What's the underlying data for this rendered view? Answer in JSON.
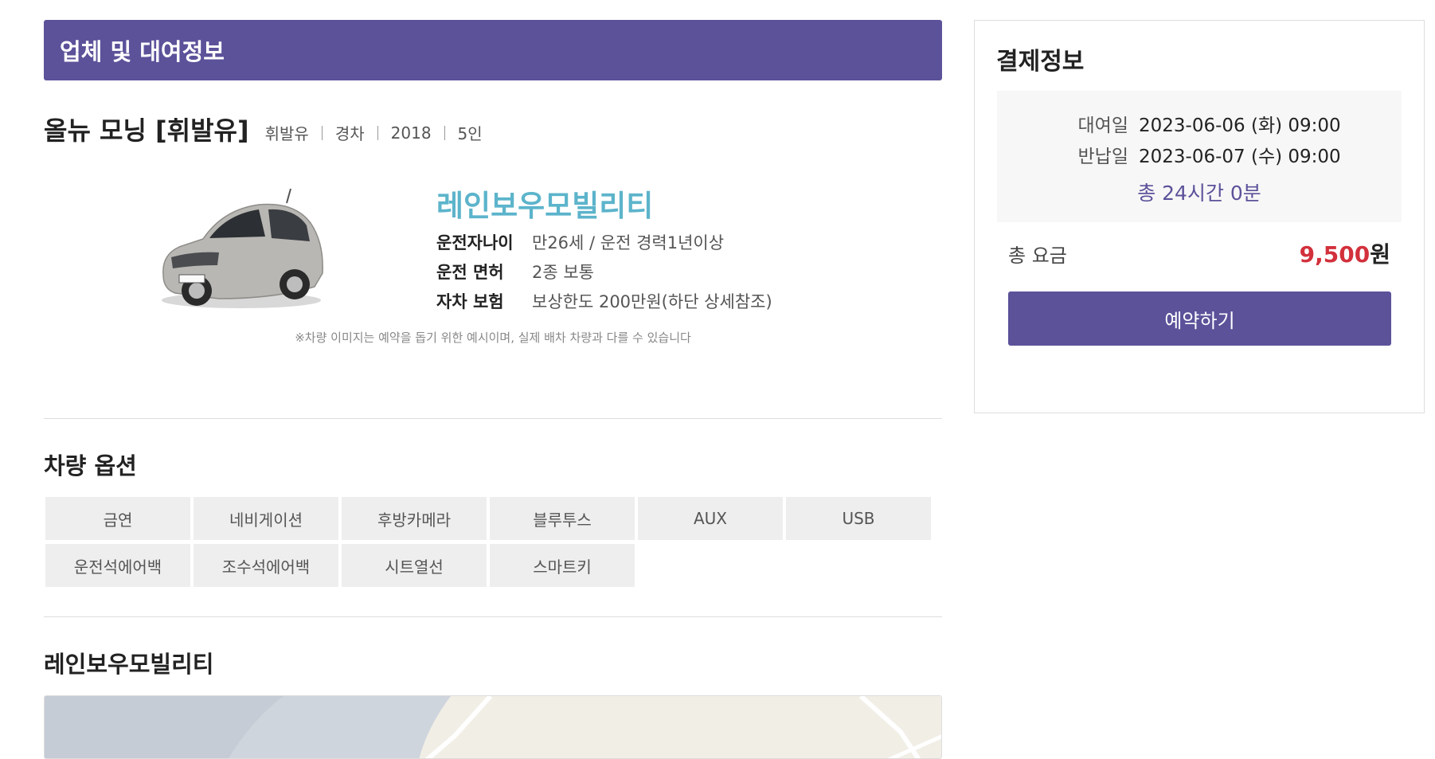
{
  "section": {
    "title": "업체 및 대여정보"
  },
  "car": {
    "name": "올뉴 모닝 [휘발유]",
    "specs": [
      "휘발유",
      "경차",
      "2018",
      "5인"
    ],
    "image_alt": "silver compact car"
  },
  "company": {
    "name": "레인보우모빌리티",
    "details": [
      {
        "label": "운전자나이",
        "value": "만26세 / 운전 경력1년이상"
      },
      {
        "label": "운전 면허",
        "value": "2종 보통"
      },
      {
        "label": "자차 보험",
        "value": "보상한도 200만원(하단 상세참조)"
      }
    ],
    "notice": "※차량 이미지는 예약을 돕기 위한 예시이며, 실제 배차 차량과 다를 수 있습니다"
  },
  "options": {
    "title": "차량 옵션",
    "items": [
      "금연",
      "네비게이션",
      "후방카메라",
      "블루투스",
      "AUX",
      "USB",
      "운전석에어백",
      "조수석에어백",
      "시트열선",
      "스마트키"
    ]
  },
  "location": {
    "title": "레인보우모빌리티"
  },
  "payment": {
    "title": "결제정보",
    "pickup_label": "대여일",
    "pickup_value": "2023-06-06 (화) 09:00",
    "return_label": "반납일",
    "return_value": "2023-06-07 (수) 09:00",
    "duration": "총 24시간 0분",
    "total_label": "총 요금",
    "total_amount": "9,500",
    "total_unit": "원",
    "reserve_label": "예약하기"
  },
  "colors": {
    "accent": "#5b529a",
    "company": "#5cb4cb",
    "price": "#d2313c"
  }
}
